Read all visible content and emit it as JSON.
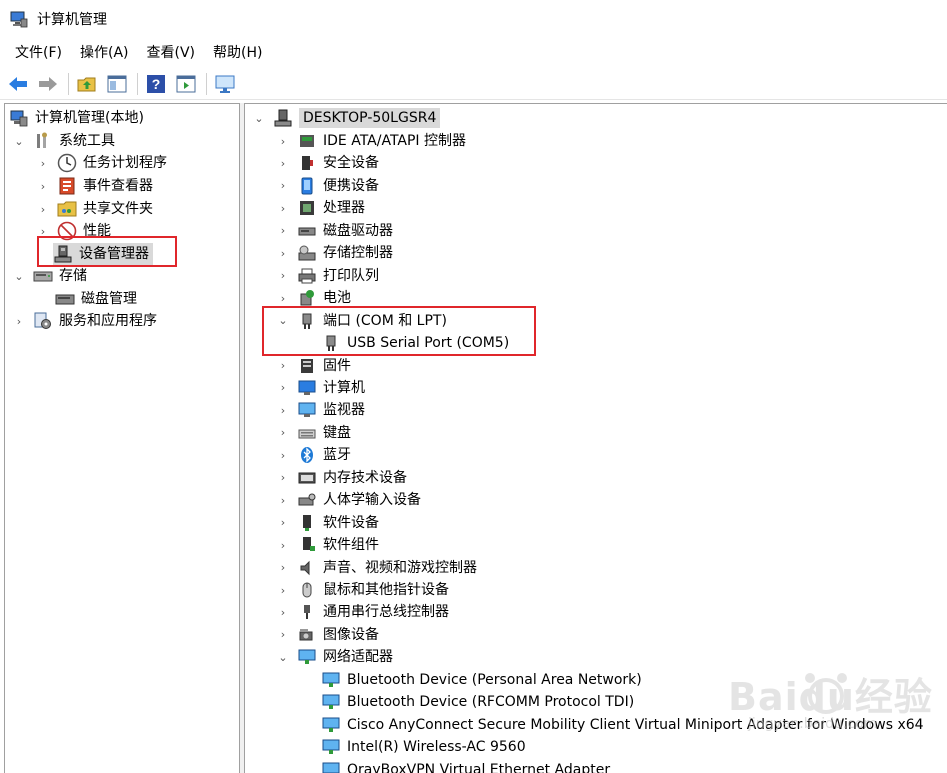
{
  "window": {
    "title": "计算机管理",
    "icon": "computer-management-icon"
  },
  "menu": [
    "文件(F)",
    "操作(A)",
    "查看(V)",
    "帮助(H)"
  ],
  "toolbar": {
    "buttons": [
      "back-arrow-icon",
      "forward-arrow-icon",
      "up-folder-icon",
      "show-hide-tree-icon",
      "help-icon",
      "properties-icon",
      "monitor-icon"
    ]
  },
  "left_tree": {
    "root": "计算机管理(本地)",
    "items": [
      {
        "label": "系统工具",
        "icon": "tools-icon",
        "expanded": true
      },
      {
        "label": "任务计划程序",
        "icon": "clock-icon"
      },
      {
        "label": "事件查看器",
        "icon": "event-viewer-icon"
      },
      {
        "label": "共享文件夹",
        "icon": "shared-folder-icon"
      },
      {
        "label": "性能",
        "icon": "performance-icon"
      },
      {
        "label": "设备管理器",
        "icon": "device-manager-icon",
        "selected": true
      },
      {
        "label": "存储",
        "icon": "storage-icon",
        "expanded": true
      },
      {
        "label": "磁盘管理",
        "icon": "disk-management-icon"
      },
      {
        "label": "服务和应用程序",
        "icon": "services-icon"
      }
    ]
  },
  "device_tree": {
    "computer": "DESKTOP-50LGSR4",
    "categories": [
      {
        "label": "IDE ATA/ATAPI 控制器",
        "icon": "ide-controller-icon"
      },
      {
        "label": "安全设备",
        "icon": "security-device-icon"
      },
      {
        "label": "便携设备",
        "icon": "portable-device-icon"
      },
      {
        "label": "处理器",
        "icon": "processor-icon"
      },
      {
        "label": "磁盘驱动器",
        "icon": "disk-drive-icon"
      },
      {
        "label": "存储控制器",
        "icon": "storage-controller-icon"
      },
      {
        "label": "打印队列",
        "icon": "printer-icon"
      },
      {
        "label": "电池",
        "icon": "battery-icon"
      },
      {
        "label": "端口 (COM 和 LPT)",
        "icon": "port-icon",
        "expanded": true,
        "children": [
          "USB Serial Port (COM5)"
        ]
      },
      {
        "label": "固件",
        "icon": "firmware-icon"
      },
      {
        "label": "计算机",
        "icon": "computer-icon"
      },
      {
        "label": "监视器",
        "icon": "monitor-icon"
      },
      {
        "label": "键盘",
        "icon": "keyboard-icon"
      },
      {
        "label": "蓝牙",
        "icon": "bluetooth-icon"
      },
      {
        "label": "内存技术设备",
        "icon": "memory-device-icon"
      },
      {
        "label": "人体学输入设备",
        "icon": "hid-icon"
      },
      {
        "label": "软件设备",
        "icon": "software-device-icon"
      },
      {
        "label": "软件组件",
        "icon": "software-component-icon"
      },
      {
        "label": "声音、视频和游戏控制器",
        "icon": "sound-icon"
      },
      {
        "label": "鼠标和其他指针设备",
        "icon": "mouse-icon"
      },
      {
        "label": "通用串行总线控制器",
        "icon": "usb-icon"
      },
      {
        "label": "图像设备",
        "icon": "camera-icon"
      },
      {
        "label": "网络适配器",
        "icon": "network-adapter-icon",
        "expanded": true,
        "children": [
          "Bluetooth Device (Personal Area Network)",
          "Bluetooth Device (RFCOMM Protocol TDI)",
          "Cisco AnyConnect Secure Mobility Client Virtual Miniport Adapter for Windows x64",
          "Intel(R) Wireless-AC 9560",
          "OrayBoxVPN Virtual Ethernet Adapter"
        ]
      }
    ]
  },
  "watermark": {
    "logo": "Baidu经验",
    "url": "jingyan.baidu.com"
  },
  "colors": {
    "highlight_box": "#e0262b",
    "selection": "#d9d9d9",
    "accent_blue": "#1e7ad6"
  }
}
